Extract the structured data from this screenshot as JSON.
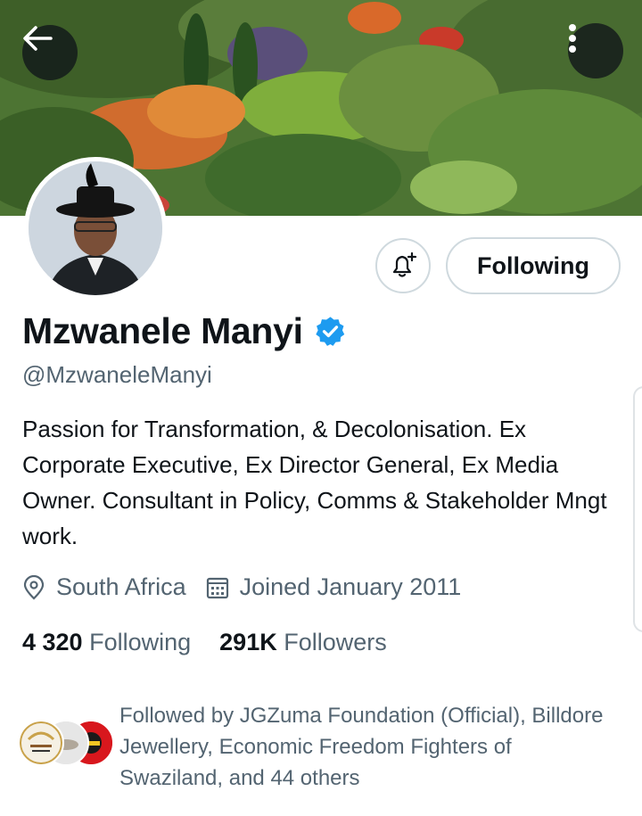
{
  "header": {
    "back_icon": "arrow-left-icon",
    "more_icon": "vertical-dots-icon"
  },
  "profile": {
    "name": "Mzwanele Manyi",
    "handle": "@MzwaneleManyi",
    "verified": true,
    "bio": "Passion for Transformation, & Decolonisation. Ex Corporate Executive, Ex Director General, Ex Media Owner. Consultant in Policy, Comms & Stakeholder Mngt work.",
    "location": "South Africa",
    "joined": "Joined January 2011",
    "following_count": "4 320",
    "following_label": "Following",
    "followers_count": "291K",
    "followers_label": "Followers"
  },
  "actions": {
    "notify_icon": "bell-plus-icon",
    "following_label": "Following"
  },
  "followed_by": {
    "text": "Followed by JGZuma Foundation (Official), Billdore Jewellery, Economic Freedom Fighters of Swaziland, and 44 others"
  },
  "colors": {
    "text_primary": "#0f1419",
    "text_secondary": "#536471",
    "verified_blue": "#1d9bf0",
    "border": "#cfd9de"
  }
}
